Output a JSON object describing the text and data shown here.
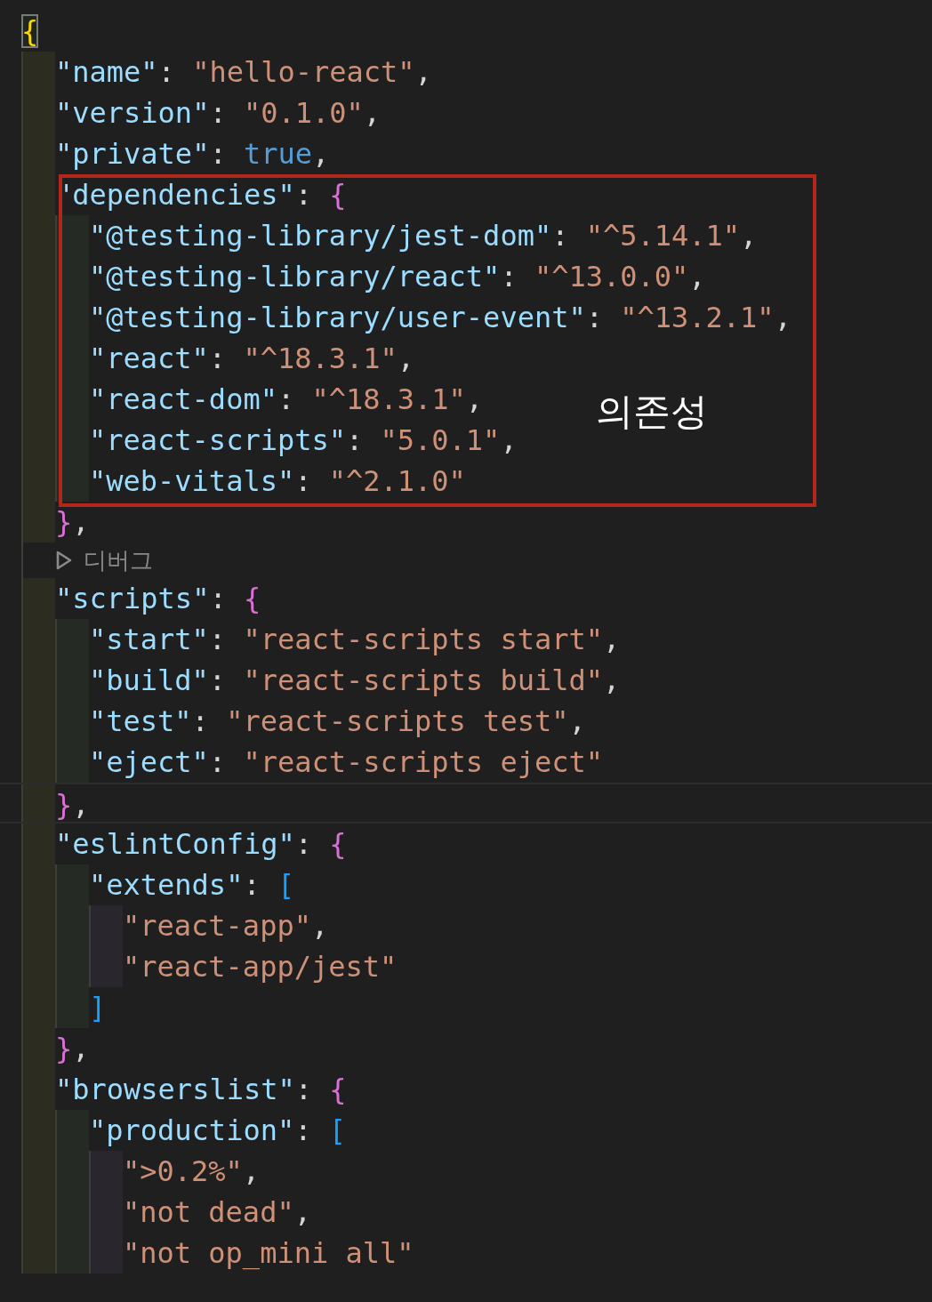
{
  "editor": {
    "lines": [
      {
        "kind": "code",
        "current": false,
        "tokens": [
          {
            "kind": "bracket",
            "text": "{",
            "color": "#ffd700",
            "matched": true
          }
        ],
        "children": [
          {
            "kind": "code",
            "current": false,
            "tokens": [
              {
                "kind": "key",
                "text": "\"name\""
              },
              {
                "kind": "punct",
                "text": ": "
              },
              {
                "kind": "string",
                "text": "\"hello-react\""
              },
              {
                "kind": "punct",
                "text": ","
              }
            ]
          },
          {
            "kind": "code",
            "current": false,
            "tokens": [
              {
                "kind": "key",
                "text": "\"version\""
              },
              {
                "kind": "punct",
                "text": ": "
              },
              {
                "kind": "string",
                "text": "\"0.1.0\""
              },
              {
                "kind": "punct",
                "text": ","
              }
            ]
          },
          {
            "kind": "code",
            "current": false,
            "tokens": [
              {
                "kind": "key",
                "text": "\"private\""
              },
              {
                "kind": "punct",
                "text": ": "
              },
              {
                "kind": "bool",
                "text": "true"
              },
              {
                "kind": "punct",
                "text": ","
              }
            ]
          },
          {
            "kind": "code",
            "current": false,
            "annotation": "의존성",
            "tokens": [
              {
                "kind": "key",
                "text": "\"dependencies\""
              },
              {
                "kind": "punct",
                "text": ": "
              },
              {
                "kind": "bracket",
                "text": "{",
                "color": "#da70d6",
                "matched": false
              }
            ],
            "children": [
              {
                "kind": "code",
                "current": false,
                "tokens": [
                  {
                    "kind": "key",
                    "text": "\"@testing-library/jest-dom\""
                  },
                  {
                    "kind": "punct",
                    "text": ": "
                  },
                  {
                    "kind": "string",
                    "text": "\"^5.14.1\""
                  },
                  {
                    "kind": "punct",
                    "text": ","
                  }
                ]
              },
              {
                "kind": "code",
                "current": false,
                "tokens": [
                  {
                    "kind": "key",
                    "text": "\"@testing-library/react\""
                  },
                  {
                    "kind": "punct",
                    "text": ": "
                  },
                  {
                    "kind": "string",
                    "text": "\"^13.0.0\""
                  },
                  {
                    "kind": "punct",
                    "text": ","
                  }
                ]
              },
              {
                "kind": "code",
                "current": false,
                "tokens": [
                  {
                    "kind": "key",
                    "text": "\"@testing-library/user-event\""
                  },
                  {
                    "kind": "punct",
                    "text": ": "
                  },
                  {
                    "kind": "string",
                    "text": "\"^13.2.1\""
                  },
                  {
                    "kind": "punct",
                    "text": ","
                  }
                ]
              },
              {
                "kind": "code",
                "current": false,
                "tokens": [
                  {
                    "kind": "key",
                    "text": "\"react\""
                  },
                  {
                    "kind": "punct",
                    "text": ": "
                  },
                  {
                    "kind": "string",
                    "text": "\"^18.3.1\""
                  },
                  {
                    "kind": "punct",
                    "text": ","
                  }
                ]
              },
              {
                "kind": "code",
                "current": false,
                "tokens": [
                  {
                    "kind": "key",
                    "text": "\"react-dom\""
                  },
                  {
                    "kind": "punct",
                    "text": ": "
                  },
                  {
                    "kind": "string",
                    "text": "\"^18.3.1\""
                  },
                  {
                    "kind": "punct",
                    "text": ","
                  }
                ]
              },
              {
                "kind": "code",
                "current": false,
                "tokens": [
                  {
                    "kind": "key",
                    "text": "\"react-scripts\""
                  },
                  {
                    "kind": "punct",
                    "text": ": "
                  },
                  {
                    "kind": "string",
                    "text": "\"5.0.1\""
                  },
                  {
                    "kind": "punct",
                    "text": ","
                  }
                ]
              },
              {
                "kind": "code",
                "current": false,
                "tokens": [
                  {
                    "kind": "key",
                    "text": "\"web-vitals\""
                  },
                  {
                    "kind": "punct",
                    "text": ": "
                  },
                  {
                    "kind": "string",
                    "text": "\"^2.1.0\""
                  }
                ]
              }
            ]
          },
          {
            "kind": "code",
            "current": false,
            "tokens": [
              {
                "kind": "bracket",
                "text": "}",
                "color": "#da70d6",
                "matched": false
              },
              {
                "kind": "punct",
                "text": ","
              }
            ]
          },
          {
            "kind": "codelens",
            "label": "디버그"
          },
          {
            "kind": "code",
            "current": false,
            "tokens": [
              {
                "kind": "key",
                "text": "\"scripts\""
              },
              {
                "kind": "punct",
                "text": ": "
              },
              {
                "kind": "bracket",
                "text": "{",
                "color": "#da70d6",
                "matched": false
              }
            ],
            "children": [
              {
                "kind": "code",
                "current": false,
                "tokens": [
                  {
                    "kind": "key",
                    "text": "\"start\""
                  },
                  {
                    "kind": "punct",
                    "text": ": "
                  },
                  {
                    "kind": "string",
                    "text": "\"react-scripts start\""
                  },
                  {
                    "kind": "punct",
                    "text": ","
                  }
                ]
              },
              {
                "kind": "code",
                "current": false,
                "tokens": [
                  {
                    "kind": "key",
                    "text": "\"build\""
                  },
                  {
                    "kind": "punct",
                    "text": ": "
                  },
                  {
                    "kind": "string",
                    "text": "\"react-scripts build\""
                  },
                  {
                    "kind": "punct",
                    "text": ","
                  }
                ]
              },
              {
                "kind": "code",
                "current": false,
                "tokens": [
                  {
                    "kind": "key",
                    "text": "\"test\""
                  },
                  {
                    "kind": "punct",
                    "text": ": "
                  },
                  {
                    "kind": "string",
                    "text": "\"react-scripts test\""
                  },
                  {
                    "kind": "punct",
                    "text": ","
                  }
                ]
              },
              {
                "kind": "code",
                "current": false,
                "tokens": [
                  {
                    "kind": "key",
                    "text": "\"eject\""
                  },
                  {
                    "kind": "punct",
                    "text": ": "
                  },
                  {
                    "kind": "string",
                    "text": "\"react-scripts eject\""
                  }
                ]
              }
            ]
          },
          {
            "kind": "code",
            "current": true,
            "tokens": [
              {
                "kind": "bracket",
                "text": "}",
                "color": "#da70d6",
                "matched": false
              },
              {
                "kind": "punct",
                "text": ","
              }
            ]
          },
          {
            "kind": "code",
            "current": false,
            "tokens": [
              {
                "kind": "key",
                "text": "\"eslintConfig\""
              },
              {
                "kind": "punct",
                "text": ": "
              },
              {
                "kind": "bracket",
                "text": "{",
                "color": "#da70d6",
                "matched": false
              }
            ],
            "children": [
              {
                "kind": "code",
                "current": false,
                "tokens": [
                  {
                    "kind": "key",
                    "text": "\"extends\""
                  },
                  {
                    "kind": "punct",
                    "text": ": "
                  },
                  {
                    "kind": "bracket",
                    "text": "[",
                    "color": "#179fff",
                    "matched": false
                  }
                ],
                "children": [
                  {
                    "kind": "code",
                    "current": false,
                    "tokens": [
                      {
                        "kind": "string",
                        "text": "\"react-app\""
                      },
                      {
                        "kind": "punct",
                        "text": ","
                      }
                    ]
                  },
                  {
                    "kind": "code",
                    "current": false,
                    "tokens": [
                      {
                        "kind": "string",
                        "text": "\"react-app/jest\""
                      }
                    ]
                  }
                ]
              },
              {
                "kind": "code",
                "current": false,
                "tokens": [
                  {
                    "kind": "bracket",
                    "text": "]",
                    "color": "#179fff",
                    "matched": false
                  }
                ]
              }
            ]
          },
          {
            "kind": "code",
            "current": false,
            "tokens": [
              {
                "kind": "bracket",
                "text": "}",
                "color": "#da70d6",
                "matched": false
              },
              {
                "kind": "punct",
                "text": ","
              }
            ]
          },
          {
            "kind": "code",
            "current": false,
            "tokens": [
              {
                "kind": "key",
                "text": "\"browserslist\""
              },
              {
                "kind": "punct",
                "text": ": "
              },
              {
                "kind": "bracket",
                "text": "{",
                "color": "#da70d6",
                "matched": false
              }
            ],
            "children": [
              {
                "kind": "code",
                "current": false,
                "tokens": [
                  {
                    "kind": "key",
                    "text": "\"production\""
                  },
                  {
                    "kind": "punct",
                    "text": ": "
                  },
                  {
                    "kind": "bracket",
                    "text": "[",
                    "color": "#179fff",
                    "matched": false
                  }
                ],
                "children": [
                  {
                    "kind": "code",
                    "current": false,
                    "tokens": [
                      {
                        "kind": "string",
                        "text": "\">0.2%\""
                      },
                      {
                        "kind": "punct",
                        "text": ","
                      }
                    ]
                  },
                  {
                    "kind": "code",
                    "current": false,
                    "tokens": [
                      {
                        "kind": "string",
                        "text": "\"not dead\""
                      },
                      {
                        "kind": "punct",
                        "text": ","
                      }
                    ]
                  },
                  {
                    "kind": "code",
                    "current": false,
                    "tokens": [
                      {
                        "kind": "string",
                        "text": "\"not op_mini all\""
                      }
                    ]
                  }
                ]
              }
            ]
          }
        ]
      }
    ]
  }
}
